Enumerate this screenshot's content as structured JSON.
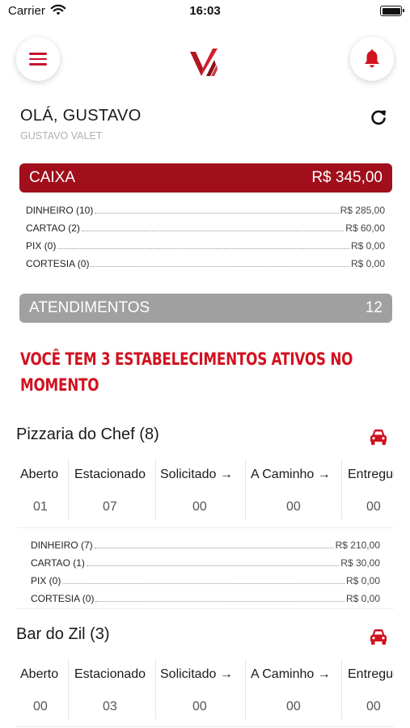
{
  "status_bar": {
    "carrier": "Carrier",
    "time": "16:03"
  },
  "header": {
    "menu_icon": "hamburger-menu-icon",
    "logo_icon": "logo-icon",
    "bell_icon": "bell-icon"
  },
  "greeting": {
    "title": "OLÁ, GUSTAVO",
    "subtitle": "GUSTAVO VALET"
  },
  "caixa": {
    "label": "CAIXA",
    "total": "R$ 345,00",
    "rows": [
      {
        "label": "DINHEIRO (10)",
        "value": "R$ 285,00"
      },
      {
        "label": "CARTAO (2)",
        "value": "R$ 60,00"
      },
      {
        "label": "PIX (0)",
        "value": "R$ 0,00"
      },
      {
        "label": "CORTESIA (0)",
        "value": "R$ 0,00"
      }
    ]
  },
  "atendimentos": {
    "label": "ATENDIMENTOS",
    "count": "12"
  },
  "notice": "VOCÊ TEM 3 ESTABELECIMENTOS ATIVOS NO MOMENTO",
  "establishments": [
    {
      "name": "Pizzaria do Chef (8)",
      "columns": [
        {
          "header": "Aberto",
          "value": "01"
        },
        {
          "header": "Estacionado",
          "value": "07"
        },
        {
          "header": "Solicitado →",
          "value": "00"
        },
        {
          "header": "A Caminho →",
          "value": "00"
        },
        {
          "header": "Entregue",
          "value": "00"
        }
      ],
      "payments": [
        {
          "label": "DINHEIRO (7)",
          "value": "R$ 210,00"
        },
        {
          "label": "CARTAO (1)",
          "value": "R$ 30,00"
        },
        {
          "label": "PIX (0)",
          "value": "R$ 0,00"
        },
        {
          "label": "CORTESIA (0)",
          "value": "R$ 0,00"
        }
      ]
    },
    {
      "name": "Bar do Zil (3)",
      "columns": [
        {
          "header": "Aberto",
          "value": "00"
        },
        {
          "header": "Estacionado",
          "value": "03"
        },
        {
          "header": "Solicitado →",
          "value": "00"
        },
        {
          "header": "A Caminho →",
          "value": "00"
        },
        {
          "header": "Entregue",
          "value": "00"
        }
      ]
    }
  ],
  "colors": {
    "brand_red": "#a00f1b",
    "accent_red": "#d1121f",
    "gray_bar": "#a0a0a0"
  }
}
